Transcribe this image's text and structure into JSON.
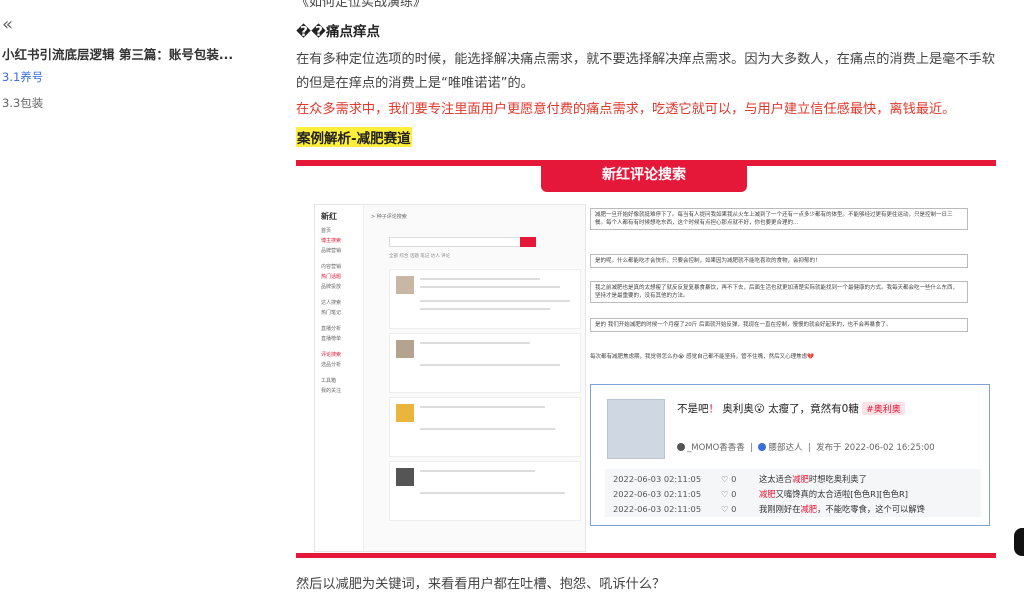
{
  "sidebar": {
    "collapse_glyph": "«",
    "doc_title": "小红书引流底层逻辑 第三篇：账号包装...",
    "items": [
      {
        "label": "3.1养号",
        "active": true
      },
      {
        "label": "3.3包装",
        "active": false
      }
    ]
  },
  "article": {
    "top_cut_text": "《如何定位实战演练》",
    "pain_heading": "��痛点痒点",
    "paragraph": "在有多种定位选项的时候，能选择解决痛点需求，就不要选择解决痒点需求。因为大多数人，在痛点的消费上是毫不手软的但是在痒点的消费上是“唯唯诺诺”的。",
    "red_paragraph": "在众多需求中，我们要专注里面用户更愿意付费的痛点需求，吃透它就可以，与用户建立信任感最快，离钱最近。",
    "case_title": "案例解析-减肥赛道",
    "bottom_cut_text": "然后以减肥为关键词，来看看用户都在吐槽、抱怨、吼诉什么？"
  },
  "screenshot": {
    "banner": "新红评论搜索",
    "app": {
      "logo": "新红",
      "crumb": "> 种子评论搜索",
      "side_items": [
        "首页",
        "博主搜索",
        "品牌营销",
        "内容营销",
        "热门话题",
        "品牌投放",
        "达人搜索",
        "热门笔记",
        "直播分析",
        "直播榜单",
        "评论搜索",
        "选品分析",
        "工具箱",
        "我的关注"
      ],
      "tabs": "全部   综合   话题   笔记   达人   评论"
    },
    "comments": [
      "减肥一旦开始好像就挺难停下了。每当有人提问我如果我从火车上减到了一个还有一点多少都有的体型。不能够经过更有更往运动，只是控制一日三餐。每个人都有有时候想吃东西，这个时候有点担心那点就不好，你也要更合理的...",
      "是的呢，什么都能吃才会快乐，只要会控制，如果因为减肥就不能吃喜欢的食物，会抑郁的！",
      "我之前减肥也是真的太想瘦了就反反复复暴食暴饮，再不下去，后面生活也就更加清楚实际就能找到一个最健康的方式。我每天都会吃一些什么东西，坚持才是最重要的，没有其他的方法。",
      "是的 我们开始减肥的时候一个月瘦了20斤 后面就开始反弹，我现在一直在控制，慢慢的就会好起来的，也不会再暴食了。",
      "每次都有减肥焦虑期，我觉得怎么办😭 感觉自己都不能坚持，管不住嘴，然后又心理焦虑💔"
    ],
    "detail": {
      "title_prefix": "不是吧",
      "title_mark": "！",
      "title_mid": "奥利奥",
      "title_emoji": "😮",
      "title_rest": "太瘦了，竟然有0糖",
      "tag": "#奥利奥",
      "author": "_MOMO香香香",
      "level": "腰部达人",
      "publish_label": "发布于",
      "publish_time": "2022-06-02 16:25:00",
      "rows": [
        {
          "time": "2022-06-03 02:11:05",
          "likes": "♡ 0",
          "pre": "这太适合",
          "hl": "减肥",
          "post": "时想吃奥利奥了"
        },
        {
          "time": "2022-06-03 02:11:05",
          "likes": "♡ 0",
          "pre": "",
          "hl": "减肥",
          "post": "又嘴馋真的太合适啦[色色R][色色R]"
        },
        {
          "time": "2022-06-03 02:11:05",
          "likes": "♡ 0",
          "pre": "我刚刚好在",
          "hl": "减肥",
          "post": "，不能吃零食，这个可以解馋"
        }
      ]
    }
  },
  "colors": {
    "accent_red": "#e5183a",
    "link_blue": "#3b6ed5",
    "highlight_yellow": "#ffef3a",
    "text_red": "#e2372b"
  }
}
